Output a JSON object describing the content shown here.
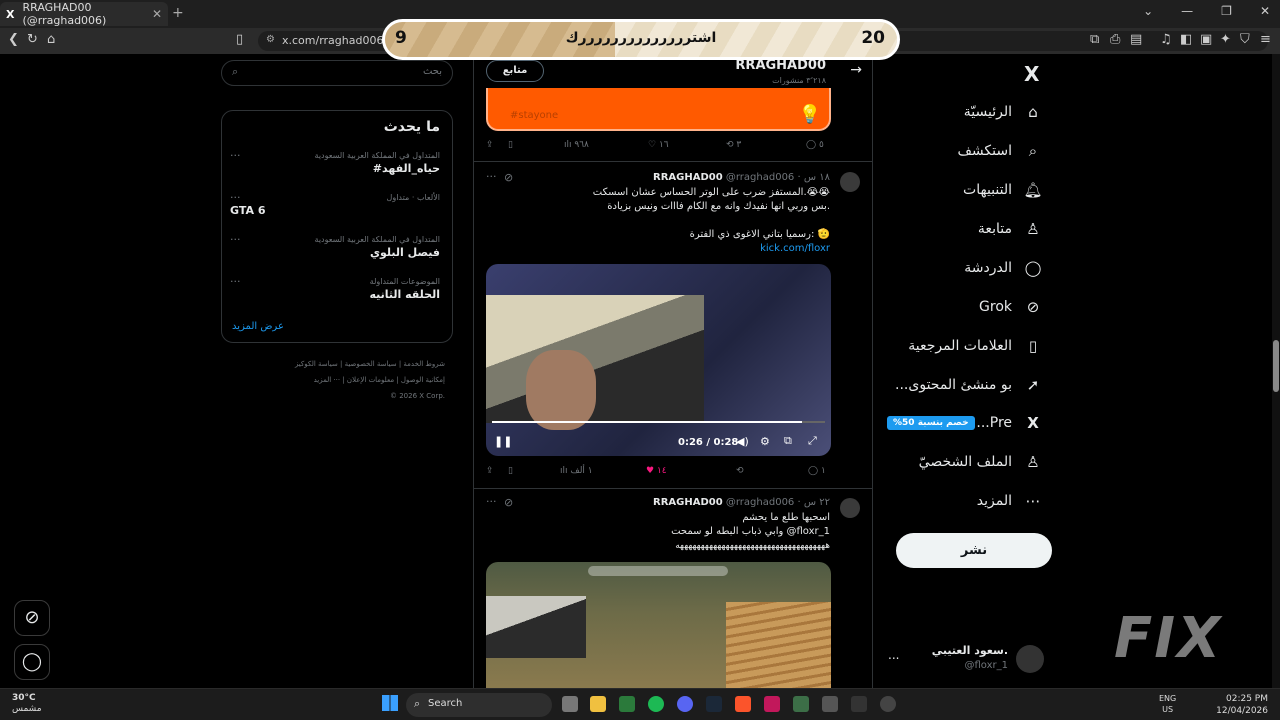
{
  "browser": {
    "tab_title": "RRAGHAD00 (@rraghad006)",
    "tab_close": "✕",
    "new_tab": "+",
    "url": "x.com/rraghad006"
  },
  "overlay": {
    "left_number": "9",
    "text": "اشتررررررررررررررك",
    "right_number": "20",
    "progress_fraction": 0.45
  },
  "sidebar_right": {
    "nav": [
      {
        "label": "الرئيسيّة",
        "icon": "home-icon",
        "glyph": "⌂"
      },
      {
        "label": "استكشف",
        "icon": "search-icon",
        "glyph": "⌕"
      },
      {
        "label": "التنبيهات",
        "icon": "bell-icon",
        "glyph": "♫"
      },
      {
        "label": "متابعة",
        "icon": "add-person-icon",
        "glyph": "♙"
      },
      {
        "label": "الدردشة",
        "icon": "chat-icon",
        "glyph": "◯"
      },
      {
        "label": "Grok",
        "icon": "grok-icon",
        "glyph": "⊘"
      },
      {
        "label": "العلامات المرجعية",
        "icon": "bookmark-icon",
        "glyph": "▯"
      },
      {
        "label": "...بو منشئ المحتوى",
        "icon": "rocket-icon",
        "glyph": "➚"
      },
      {
        "label": "...Pre",
        "icon": "x-premium-icon",
        "glyph": "X"
      },
      {
        "label": "الملف الشخصيّ",
        "icon": "profile-icon",
        "glyph": "♙"
      },
      {
        "label": "المزيد",
        "icon": "more-icon",
        "glyph": "⋯"
      }
    ],
    "premium_badge": "%خصم بنسبة 50",
    "post_button": "نشر",
    "account_name": "سعود العتيبي.",
    "account_handle": "@floxr_1",
    "account_dots": "..."
  },
  "profile_header": {
    "name": "RRAGHAD00",
    "posts": "٣٬٢١٨ منشورات",
    "follow_button": "متابع",
    "back": "→"
  },
  "tweet0": {
    "hashtag": "#stayone",
    "replies": "٥",
    "retweets": "٣",
    "likes": "١٦",
    "views": "٩٦٨"
  },
  "tweet1": {
    "name": "RRAGHAD00",
    "handle": "@rraghad006",
    "time": "· ١٨ س",
    "line1": "المستفز ضرب على الوتر الحساس عشان اسسكت.😭😭",
    "line2": "بس وربي انها نفيدك وانه مع الكام فااات ونيس بزيادة.",
    "line3": "رسميا بتاني الاغوى ذي الفترة: 🫡",
    "link": "kick.com/floxr",
    "video_time": "0:26 / 0:28",
    "video_progress": 0.93,
    "replies": "١",
    "likes": "١٤",
    "views": "١ ألف"
  },
  "tweet2": {
    "name": "RRAGHAD00",
    "handle": "@rraghad006",
    "time": "· ٢٢ س",
    "line1": "اسحبها طلع  ما يحشم",
    "line2": "وابي ذباب البطه لو سمحت @floxr_1",
    "line3": "ههههههههههههههههههههههههههههههههههههه"
  },
  "sidebar_left": {
    "search_placeholder": "بحث",
    "trends_title": "ما يحدث",
    "trends": [
      {
        "context": "المتداول في المملكة العربية السعودية",
        "name": "#حياه_الفهد"
      },
      {
        "context": "الألعاب · متداول",
        "name": "GTA 6"
      },
      {
        "context": "المتداول في المملكة العربية السعودية",
        "name": "فيصل البلوي"
      },
      {
        "context": "الموضوعات المتداولة",
        "name": "الحلقه الثانيه"
      }
    ],
    "show_more": "عرض المزيد",
    "footer": [
      "شروط الخدمة | سياسة الخصوصية | سياسة الكوكيز",
      "إمكانية الوصول | معلومات الإعلان | ··· المزيد",
      "© 2026 X Corp."
    ]
  },
  "taskbar": {
    "temp": "30°C",
    "weather": "مشمس",
    "search": "Search",
    "lang": "ENG",
    "region": "US",
    "time": "02:25 PM",
    "date": "12/04/2026"
  },
  "watermark": "FIX"
}
